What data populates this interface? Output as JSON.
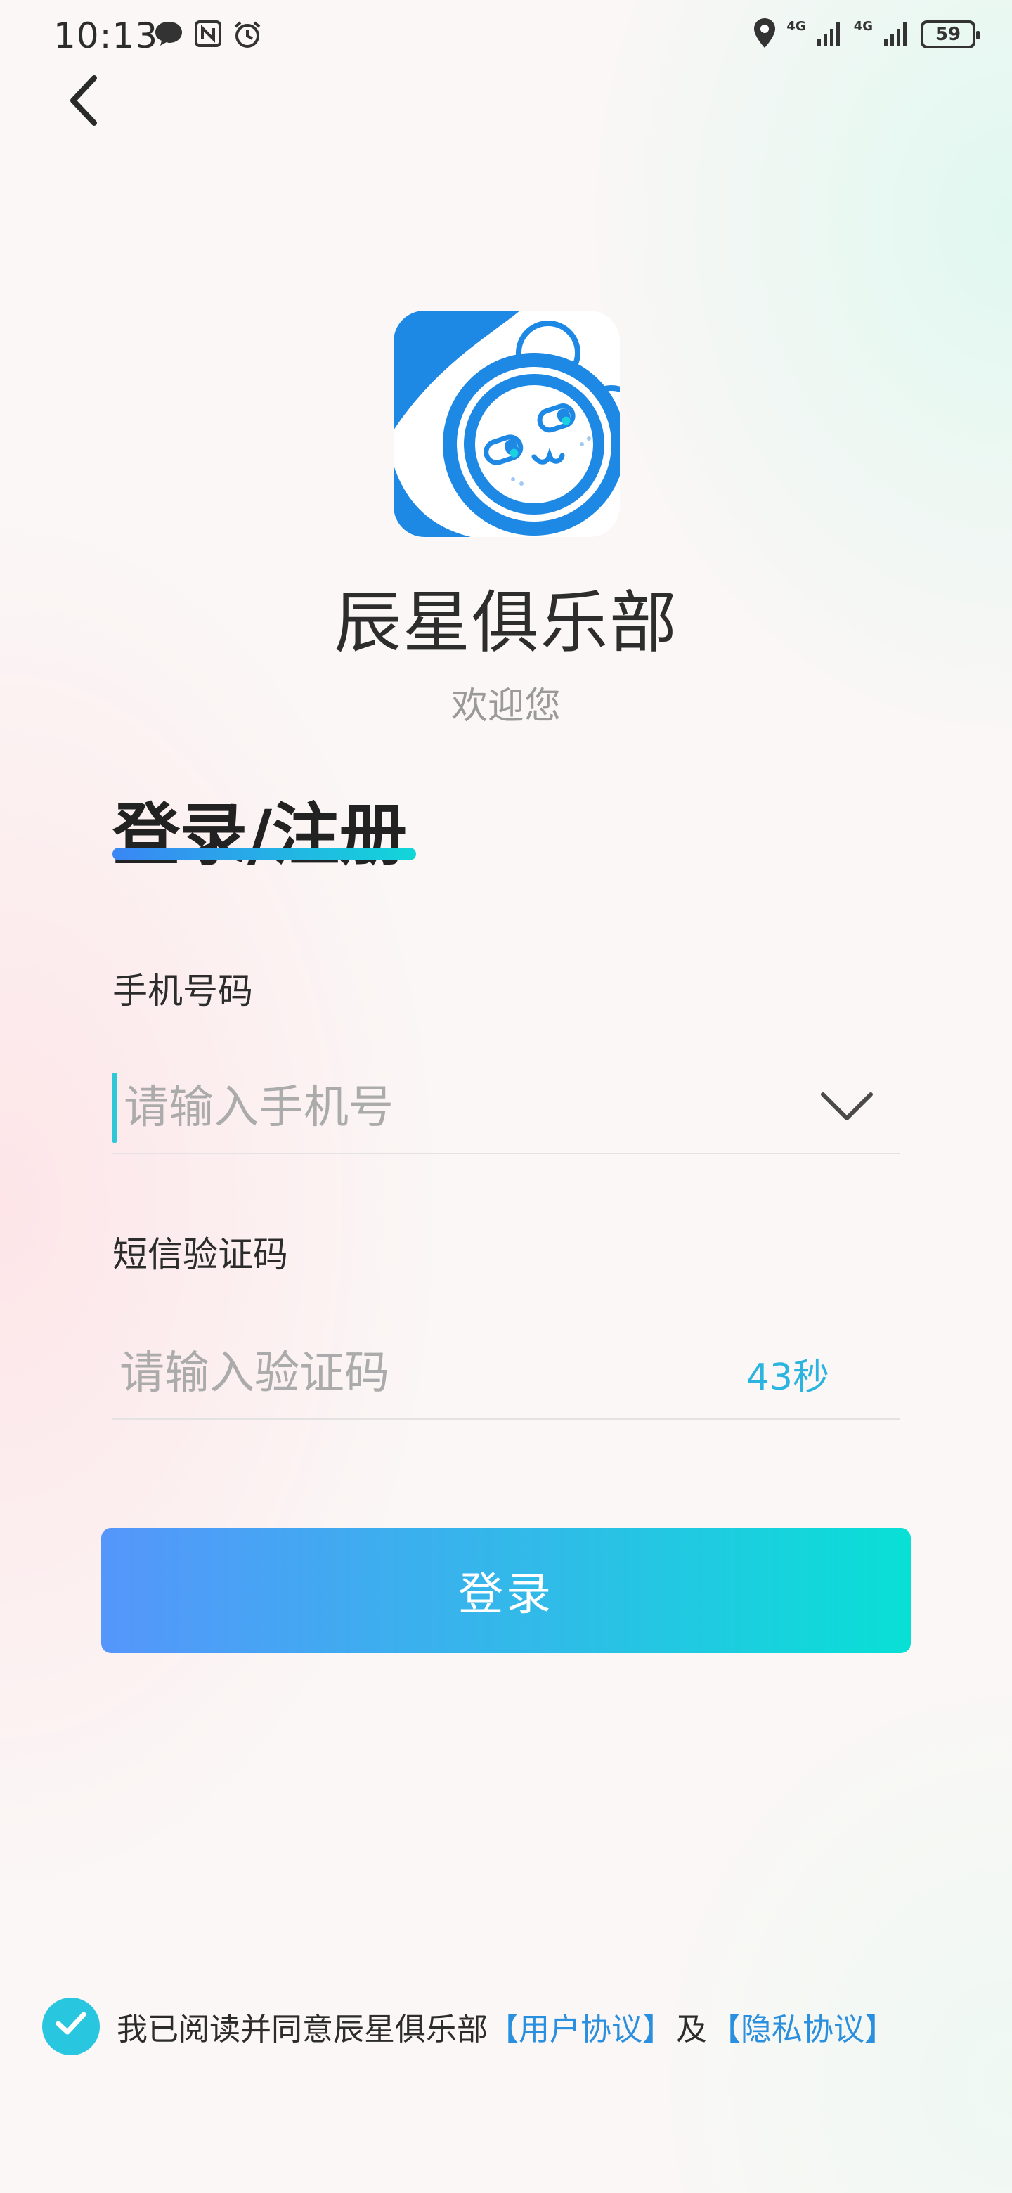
{
  "status_bar": {
    "time": "10:13",
    "network_1": "4G",
    "network_2": "4G",
    "battery": "59",
    "icons": [
      "message-icon",
      "nfc-icon",
      "alarm-icon",
      "location-icon",
      "signal-icon",
      "signal-icon",
      "battery-icon"
    ]
  },
  "header": {
    "back_icon": "chevron-left-icon"
  },
  "app": {
    "name": "辰星俱乐部",
    "welcome": "欢迎您"
  },
  "form": {
    "title": "登录/注册",
    "phone": {
      "label": "手机号码",
      "placeholder": "请输入手机号",
      "value": ""
    },
    "code": {
      "label": "短信验证码",
      "placeholder": "请输入验证码",
      "value": "",
      "countdown": "43秒"
    },
    "submit_label": "登录"
  },
  "agreement": {
    "checked": true,
    "text": "我已阅读并同意辰星俱乐部",
    "user_link": "【用户协议】",
    "and": "及",
    "privacy_link": "【隐私协议】"
  },
  "colors": {
    "accent": "#2bb4e0",
    "gradient_start": "#5596fb",
    "gradient_end": "#08e0d6",
    "logo_blue": "#1e88e5"
  }
}
